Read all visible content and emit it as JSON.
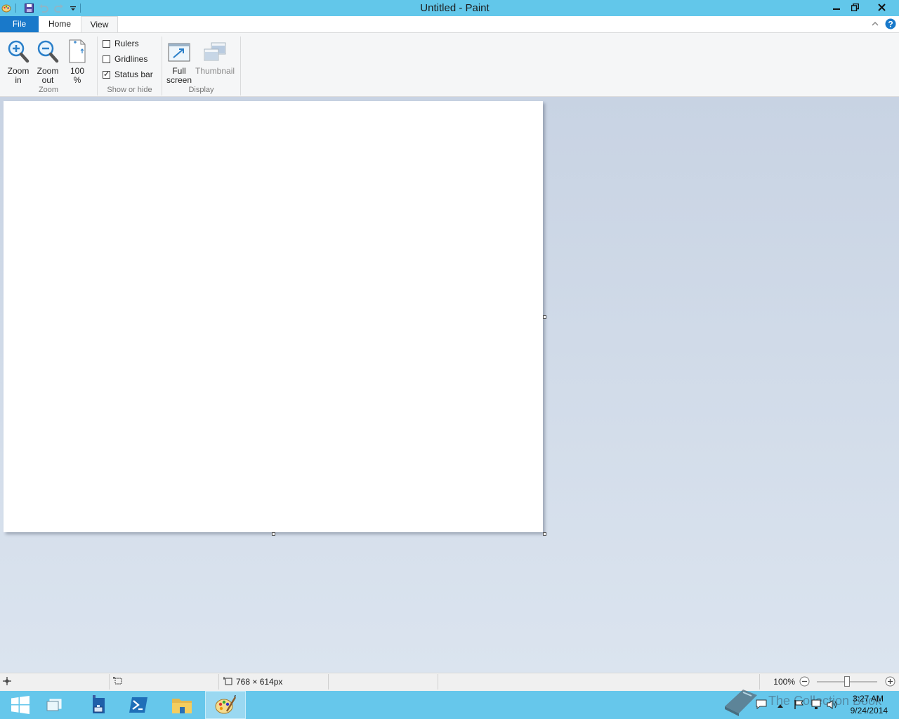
{
  "window": {
    "title": "Untitled - Paint"
  },
  "tabs": {
    "file": "File",
    "home": "Home",
    "view": "View"
  },
  "ribbon": {
    "zoom": {
      "zoom_in": [
        "Zoom",
        "in"
      ],
      "zoom_out": [
        "Zoom",
        "out"
      ],
      "hundred": [
        "100",
        "%"
      ],
      "group_label": "Zoom"
    },
    "show_hide": {
      "rulers": "Rulers",
      "rulers_checked": false,
      "gridlines": "Gridlines",
      "gridlines_checked": false,
      "status_bar": "Status bar",
      "status_bar_checked": true,
      "group_label": "Show or hide"
    },
    "display": {
      "full_screen": [
        "Full",
        "screen"
      ],
      "thumbnail": "Thumbnail",
      "group_label": "Display"
    }
  },
  "statusbar": {
    "image_size": "768 × 614px",
    "zoom_level": "100%",
    "zoom_slider_value": 100
  },
  "taskbar": {
    "clock_time": "3:27 AM",
    "clock_date": "9/24/2014",
    "watermark": "The Collection Book"
  },
  "colors": {
    "titlebar": "#62c7ea",
    "file_tab": "#1979ca",
    "taskbar": "#66c7eb"
  }
}
